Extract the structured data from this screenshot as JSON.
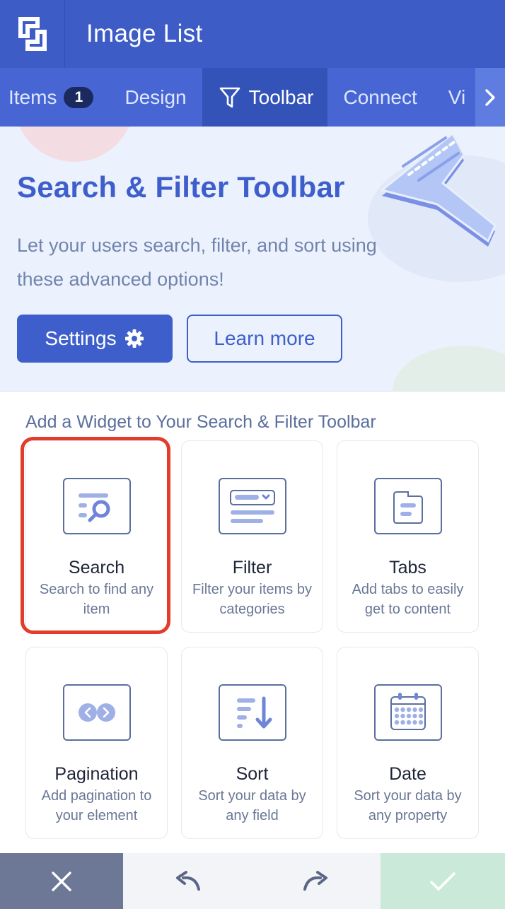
{
  "app": {
    "title": "Image List"
  },
  "tabs": [
    {
      "label": "Items",
      "badge": "1"
    },
    {
      "label": "Design"
    },
    {
      "label": "Toolbar",
      "active": true
    },
    {
      "label": "Connect"
    },
    {
      "label": "Vi"
    }
  ],
  "hero": {
    "title": "Search & Filter Toolbar",
    "description": "Let your users search, filter, and sort using these advanced options!",
    "settings_label": "Settings",
    "learn_more_label": "Learn more"
  },
  "widgets": {
    "section_title": "Add a Widget to Your Search & Filter Toolbar",
    "items": [
      {
        "name": "Search",
        "desc": "Search to find any item",
        "icon": "search-widget-icon",
        "selected": true
      },
      {
        "name": "Filter",
        "desc": "Filter your items by categories",
        "icon": "filter-widget-icon"
      },
      {
        "name": "Tabs",
        "desc": "Add tabs to easily get to content",
        "icon": "tabs-widget-icon"
      },
      {
        "name": "Pagination",
        "desc": "Add pagination to your element",
        "icon": "pagination-widget-icon"
      },
      {
        "name": "Sort",
        "desc": "Sort your data by any field",
        "icon": "sort-widget-icon"
      },
      {
        "name": "Date",
        "desc": "Sort your data by any property",
        "icon": "calendar-widget-icon"
      }
    ]
  },
  "bottom_bar": {
    "close_icon": "close-icon",
    "undo_icon": "undo-icon",
    "redo_icon": "redo-icon",
    "confirm_icon": "check-icon"
  },
  "colors": {
    "primary": "#3e5fcb",
    "header": "#3d5cc6",
    "highlight": "#e23d2a",
    "confirm": "#cbe9d9"
  }
}
